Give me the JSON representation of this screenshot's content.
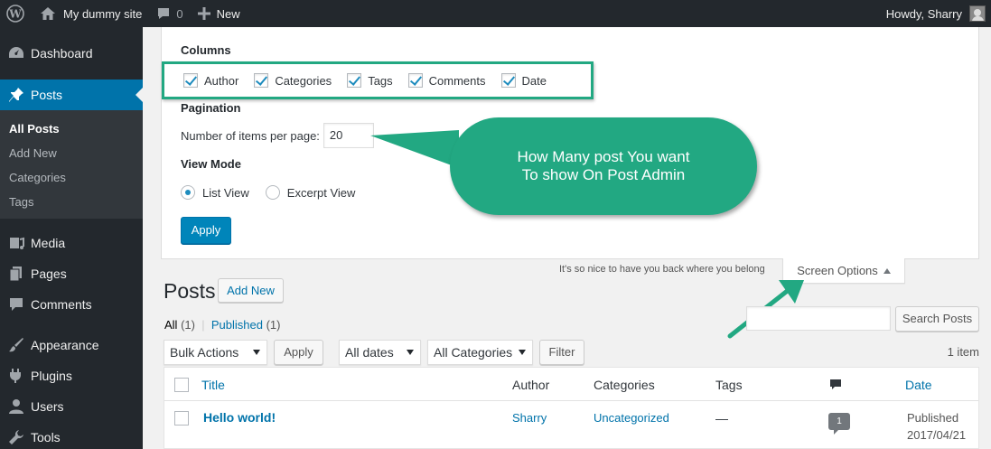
{
  "adminbar": {
    "site_name": "My dummy site",
    "comments_count": "0",
    "new_label": "New",
    "greeting": "Howdy, Sharry"
  },
  "sidebar": {
    "items": [
      {
        "label": "Dashboard",
        "icon": "dashboard-icon"
      },
      {
        "label": "Posts",
        "icon": "pushpin-icon"
      },
      {
        "label": "Media",
        "icon": "media-icon"
      },
      {
        "label": "Pages",
        "icon": "pages-icon"
      },
      {
        "label": "Comments",
        "icon": "comment-icon"
      },
      {
        "label": "Appearance",
        "icon": "paintbrush-icon"
      },
      {
        "label": "Plugins",
        "icon": "plugin-icon"
      },
      {
        "label": "Users",
        "icon": "user-icon"
      },
      {
        "label": "Tools",
        "icon": "wrench-icon"
      }
    ],
    "submenu": [
      "All Posts",
      "Add New",
      "Categories",
      "Tags"
    ]
  },
  "screen_options": {
    "columns_heading": "Columns",
    "columns": [
      {
        "label": "Author",
        "checked": true
      },
      {
        "label": "Categories",
        "checked": true
      },
      {
        "label": "Tags",
        "checked": true
      },
      {
        "label": "Comments",
        "checked": true
      },
      {
        "label": "Date",
        "checked": true
      }
    ],
    "pagination_heading": "Pagination",
    "per_page_label": "Number of items per page:",
    "per_page_value": "20",
    "view_mode_heading": "View Mode",
    "view_modes": [
      {
        "label": "List View",
        "selected": true
      },
      {
        "label": "Excerpt View",
        "selected": false
      }
    ],
    "apply_label": "Apply",
    "tab_label": "Screen Options",
    "tagline": "It's so nice to have you back where you belong"
  },
  "callout": {
    "line1": "How Many post You want",
    "line2": "To show On Post Admin",
    "color": "#22a882"
  },
  "posts": {
    "title": "Posts",
    "add_new_label": "Add New",
    "filter_all": "All",
    "filter_all_count": "(1)",
    "separator": "|",
    "filter_published": "Published",
    "filter_published_count": "(1)",
    "search_button": "Search Posts",
    "bulk_actions": "Bulk Actions",
    "bulk_apply": "Apply",
    "dates_filter": "All dates",
    "categories_filter": "All Categories",
    "filter_button": "Filter",
    "item_count": "1 item",
    "columns": {
      "title": "Title",
      "author": "Author",
      "categories": "Categories",
      "tags": "Tags",
      "date": "Date"
    },
    "rows": [
      {
        "title": "Hello world!",
        "author": "Sharry",
        "categories": "Uncategorized",
        "tags": "—",
        "comments": "1",
        "date_status": "Published",
        "date": "2017/04/21"
      }
    ]
  },
  "colors": {
    "admin_dark": "#23282d",
    "accent_blue": "#0073aa",
    "annotation_green": "#22a882"
  }
}
